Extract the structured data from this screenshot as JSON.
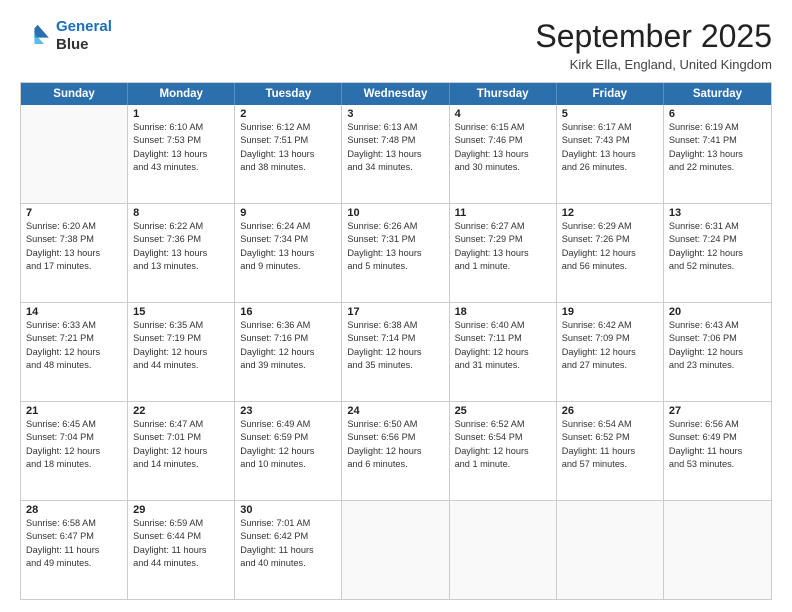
{
  "header": {
    "logo_line1": "General",
    "logo_line2": "Blue",
    "month": "September 2025",
    "location": "Kirk Ella, England, United Kingdom"
  },
  "weekdays": [
    "Sunday",
    "Monday",
    "Tuesday",
    "Wednesday",
    "Thursday",
    "Friday",
    "Saturday"
  ],
  "rows": [
    [
      {
        "day": "",
        "lines": []
      },
      {
        "day": "1",
        "lines": [
          "Sunrise: 6:10 AM",
          "Sunset: 7:53 PM",
          "Daylight: 13 hours",
          "and 43 minutes."
        ]
      },
      {
        "day": "2",
        "lines": [
          "Sunrise: 6:12 AM",
          "Sunset: 7:51 PM",
          "Daylight: 13 hours",
          "and 38 minutes."
        ]
      },
      {
        "day": "3",
        "lines": [
          "Sunrise: 6:13 AM",
          "Sunset: 7:48 PM",
          "Daylight: 13 hours",
          "and 34 minutes."
        ]
      },
      {
        "day": "4",
        "lines": [
          "Sunrise: 6:15 AM",
          "Sunset: 7:46 PM",
          "Daylight: 13 hours",
          "and 30 minutes."
        ]
      },
      {
        "day": "5",
        "lines": [
          "Sunrise: 6:17 AM",
          "Sunset: 7:43 PM",
          "Daylight: 13 hours",
          "and 26 minutes."
        ]
      },
      {
        "day": "6",
        "lines": [
          "Sunrise: 6:19 AM",
          "Sunset: 7:41 PM",
          "Daylight: 13 hours",
          "and 22 minutes."
        ]
      }
    ],
    [
      {
        "day": "7",
        "lines": [
          "Sunrise: 6:20 AM",
          "Sunset: 7:38 PM",
          "Daylight: 13 hours",
          "and 17 minutes."
        ]
      },
      {
        "day": "8",
        "lines": [
          "Sunrise: 6:22 AM",
          "Sunset: 7:36 PM",
          "Daylight: 13 hours",
          "and 13 minutes."
        ]
      },
      {
        "day": "9",
        "lines": [
          "Sunrise: 6:24 AM",
          "Sunset: 7:34 PM",
          "Daylight: 13 hours",
          "and 9 minutes."
        ]
      },
      {
        "day": "10",
        "lines": [
          "Sunrise: 6:26 AM",
          "Sunset: 7:31 PM",
          "Daylight: 13 hours",
          "and 5 minutes."
        ]
      },
      {
        "day": "11",
        "lines": [
          "Sunrise: 6:27 AM",
          "Sunset: 7:29 PM",
          "Daylight: 13 hours",
          "and 1 minute."
        ]
      },
      {
        "day": "12",
        "lines": [
          "Sunrise: 6:29 AM",
          "Sunset: 7:26 PM",
          "Daylight: 12 hours",
          "and 56 minutes."
        ]
      },
      {
        "day": "13",
        "lines": [
          "Sunrise: 6:31 AM",
          "Sunset: 7:24 PM",
          "Daylight: 12 hours",
          "and 52 minutes."
        ]
      }
    ],
    [
      {
        "day": "14",
        "lines": [
          "Sunrise: 6:33 AM",
          "Sunset: 7:21 PM",
          "Daylight: 12 hours",
          "and 48 minutes."
        ]
      },
      {
        "day": "15",
        "lines": [
          "Sunrise: 6:35 AM",
          "Sunset: 7:19 PM",
          "Daylight: 12 hours",
          "and 44 minutes."
        ]
      },
      {
        "day": "16",
        "lines": [
          "Sunrise: 6:36 AM",
          "Sunset: 7:16 PM",
          "Daylight: 12 hours",
          "and 39 minutes."
        ]
      },
      {
        "day": "17",
        "lines": [
          "Sunrise: 6:38 AM",
          "Sunset: 7:14 PM",
          "Daylight: 12 hours",
          "and 35 minutes."
        ]
      },
      {
        "day": "18",
        "lines": [
          "Sunrise: 6:40 AM",
          "Sunset: 7:11 PM",
          "Daylight: 12 hours",
          "and 31 minutes."
        ]
      },
      {
        "day": "19",
        "lines": [
          "Sunrise: 6:42 AM",
          "Sunset: 7:09 PM",
          "Daylight: 12 hours",
          "and 27 minutes."
        ]
      },
      {
        "day": "20",
        "lines": [
          "Sunrise: 6:43 AM",
          "Sunset: 7:06 PM",
          "Daylight: 12 hours",
          "and 23 minutes."
        ]
      }
    ],
    [
      {
        "day": "21",
        "lines": [
          "Sunrise: 6:45 AM",
          "Sunset: 7:04 PM",
          "Daylight: 12 hours",
          "and 18 minutes."
        ]
      },
      {
        "day": "22",
        "lines": [
          "Sunrise: 6:47 AM",
          "Sunset: 7:01 PM",
          "Daylight: 12 hours",
          "and 14 minutes."
        ]
      },
      {
        "day": "23",
        "lines": [
          "Sunrise: 6:49 AM",
          "Sunset: 6:59 PM",
          "Daylight: 12 hours",
          "and 10 minutes."
        ]
      },
      {
        "day": "24",
        "lines": [
          "Sunrise: 6:50 AM",
          "Sunset: 6:56 PM",
          "Daylight: 12 hours",
          "and 6 minutes."
        ]
      },
      {
        "day": "25",
        "lines": [
          "Sunrise: 6:52 AM",
          "Sunset: 6:54 PM",
          "Daylight: 12 hours",
          "and 1 minute."
        ]
      },
      {
        "day": "26",
        "lines": [
          "Sunrise: 6:54 AM",
          "Sunset: 6:52 PM",
          "Daylight: 11 hours",
          "and 57 minutes."
        ]
      },
      {
        "day": "27",
        "lines": [
          "Sunrise: 6:56 AM",
          "Sunset: 6:49 PM",
          "Daylight: 11 hours",
          "and 53 minutes."
        ]
      }
    ],
    [
      {
        "day": "28",
        "lines": [
          "Sunrise: 6:58 AM",
          "Sunset: 6:47 PM",
          "Daylight: 11 hours",
          "and 49 minutes."
        ]
      },
      {
        "day": "29",
        "lines": [
          "Sunrise: 6:59 AM",
          "Sunset: 6:44 PM",
          "Daylight: 11 hours",
          "and 44 minutes."
        ]
      },
      {
        "day": "30",
        "lines": [
          "Sunrise: 7:01 AM",
          "Sunset: 6:42 PM",
          "Daylight: 11 hours",
          "and 40 minutes."
        ]
      },
      {
        "day": "",
        "lines": []
      },
      {
        "day": "",
        "lines": []
      },
      {
        "day": "",
        "lines": []
      },
      {
        "day": "",
        "lines": []
      }
    ]
  ]
}
